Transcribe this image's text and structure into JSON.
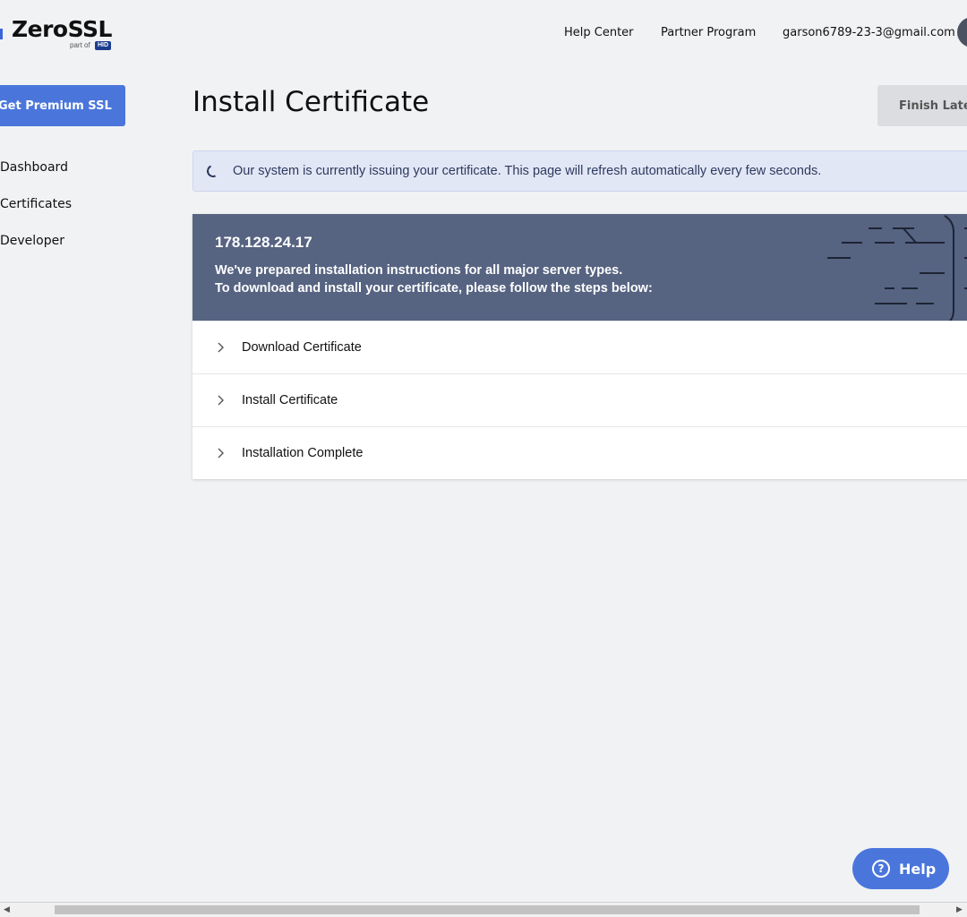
{
  "header": {
    "logo_text": "ZeroSSL",
    "logo_partof": "part of",
    "logo_badge": "HID",
    "nav": [
      "Help Center",
      "Partner Program",
      "garson6789-23-3@gmail.com"
    ]
  },
  "sidebar": {
    "premium_button": "Get Premium SSL",
    "items": [
      "Dashboard",
      "Certificates",
      "Developer"
    ]
  },
  "main": {
    "title": "Install Certificate",
    "finish_button": "Finish Later",
    "notice": "Our system is currently issuing your certificate. This page will refresh automatically every few seconds.",
    "card": {
      "ip": "178.128.24.17",
      "line1": "We've prepared installation instructions for all major server types.",
      "line2": "To download and install your certificate, please follow the steps below:",
      "steps": [
        "Download Certificate",
        "Install Certificate",
        "Installation Complete"
      ]
    }
  },
  "help_button": "Help",
  "colors": {
    "accent": "#4a76dc",
    "card_header": "#566381",
    "background": "#f1f2f4",
    "notice_bg": "#e2e7f6"
  }
}
